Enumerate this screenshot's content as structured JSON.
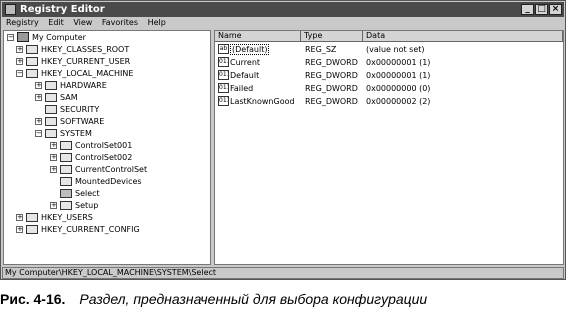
{
  "window": {
    "title": "Registry Editor",
    "controls": {
      "minimize": "_",
      "maximize": "□",
      "close": "×"
    }
  },
  "menu": {
    "items": [
      "Registry",
      "Edit",
      "View",
      "Favorites",
      "Help"
    ]
  },
  "tree": {
    "root": {
      "label": "My Computer",
      "toggle": "−",
      "icon": "computer-icon"
    },
    "hives": [
      {
        "label": "HKEY_CLASSES_ROOT",
        "toggle": "+"
      },
      {
        "label": "HKEY_CURRENT_USER",
        "toggle": "+"
      },
      {
        "label": "HKEY_LOCAL_MACHINE",
        "toggle": "−"
      }
    ],
    "hklm_children": [
      {
        "label": "HARDWARE",
        "toggle": "+"
      },
      {
        "label": "SAM",
        "toggle": "+"
      },
      {
        "label": "SECURITY",
        "toggle": ""
      },
      {
        "label": "SOFTWARE",
        "toggle": "+"
      },
      {
        "label": "SYSTEM",
        "toggle": "−"
      }
    ],
    "system_children": [
      {
        "label": "ControlSet001",
        "toggle": "+"
      },
      {
        "label": "ControlSet002",
        "toggle": "+"
      },
      {
        "label": "CurrentControlSet",
        "toggle": "+"
      },
      {
        "label": "MountedDevices",
        "toggle": ""
      },
      {
        "label": "Select",
        "toggle": "",
        "selected": true
      },
      {
        "label": "Setup",
        "toggle": "+"
      }
    ],
    "trailing_hives": [
      {
        "label": "HKEY_USERS",
        "toggle": "+"
      },
      {
        "label": "HKEY_CURRENT_CONFIG",
        "toggle": "+"
      }
    ]
  },
  "list": {
    "columns": [
      "Name",
      "Type",
      "Data"
    ],
    "rows": [
      {
        "name": "(Default)",
        "type": "REG_SZ",
        "data": "(value not set)",
        "icon": "ab",
        "icon_name": "string-value-icon"
      },
      {
        "name": "Current",
        "type": "REG_DWORD",
        "data": "0x00000001 (1)",
        "icon": "011",
        "icon_name": "binary-value-icon"
      },
      {
        "name": "Default",
        "type": "REG_DWORD",
        "data": "0x00000001 (1)",
        "icon": "011",
        "icon_name": "binary-value-icon"
      },
      {
        "name": "Failed",
        "type": "REG_DWORD",
        "data": "0x00000000 (0)",
        "icon": "011",
        "icon_name": "binary-value-icon"
      },
      {
        "name": "LastKnownGood",
        "type": "REG_DWORD",
        "data": "0x00000002 (2)",
        "icon": "011",
        "icon_name": "binary-value-icon"
      }
    ]
  },
  "status_bar": {
    "path": "My Computer\\HKEY_LOCAL_MACHINE\\SYSTEM\\Select"
  },
  "caption": {
    "label": "Рис. 4-16.",
    "text": "Раздел, предназначенный для выбора конфигурации"
  }
}
